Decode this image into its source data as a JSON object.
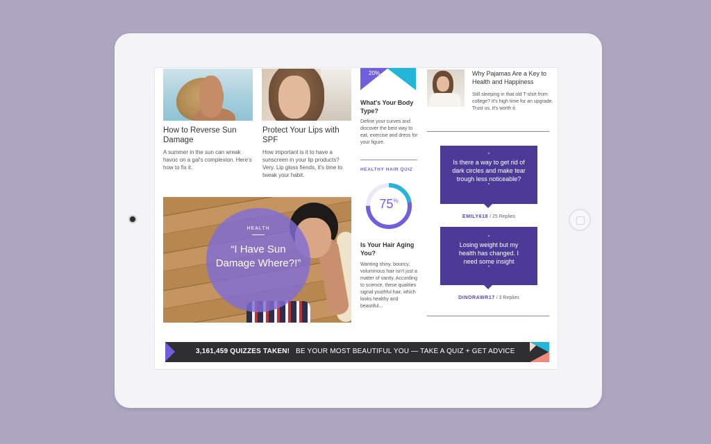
{
  "articles": [
    {
      "title": "How to Reverse Sun Damage",
      "desc": "A summer in the sun can wreak havoc on a gal's complexion. Here's how to fix it."
    },
    {
      "title": "Protect Your Lips with SPF",
      "desc": "How important is it to have a sunscreen in your lip products? Very. Lip gloss fiends, it's time to tweak your habit."
    }
  ],
  "feature": {
    "tag": "HEALTH",
    "quote": "“I Have Sun Damage Where?!”"
  },
  "body_type": {
    "badge": "20%",
    "title": "What's Your Body Type?",
    "desc": "Define your curves and discover the best way to eat, exercise and dress for your figure."
  },
  "hair_quiz": {
    "label": "HEALTHY HAIR QUIZ",
    "value": "75",
    "unit": "%",
    "progress": 0.75,
    "title": "Is Your Hair Aging You?",
    "desc": "Wanting shiny, bouncy, voluminous hair isn't just a matter of vanity. According to science, these qualities signal youthful hair, which looks healthy and beautiful..."
  },
  "pajamas": {
    "title": "Why Pajamas Are a Key to Health and Happiness",
    "desc": "Still sleeping in that old T-shirt from college? It's high time for an upgrade. Trust us, it's worth it."
  },
  "questions": [
    {
      "open": "“",
      "text": "Is there a way to get rid of dark circles and make tear trough less noticeable?",
      "close": "”",
      "user": "EMILY618",
      "replies": " / 25 Replies"
    },
    {
      "open": "“",
      "text": "Losing weight but my health has changed. I need some insight",
      "close": "”",
      "user": "DINORAWR17",
      "replies": " / 3 Replies"
    }
  ],
  "banner": {
    "count": "3,161,459 QUIZZES TAKEN!",
    "message": "BE YOUR MOST BEAUTIFUL YOU — TAKE A QUIZ + GET ADVICE"
  },
  "colors": {
    "accent": "#6f5fdc",
    "teal": "#23b6d8",
    "bubble": "#4b3b96",
    "background": "#aca6c0"
  }
}
